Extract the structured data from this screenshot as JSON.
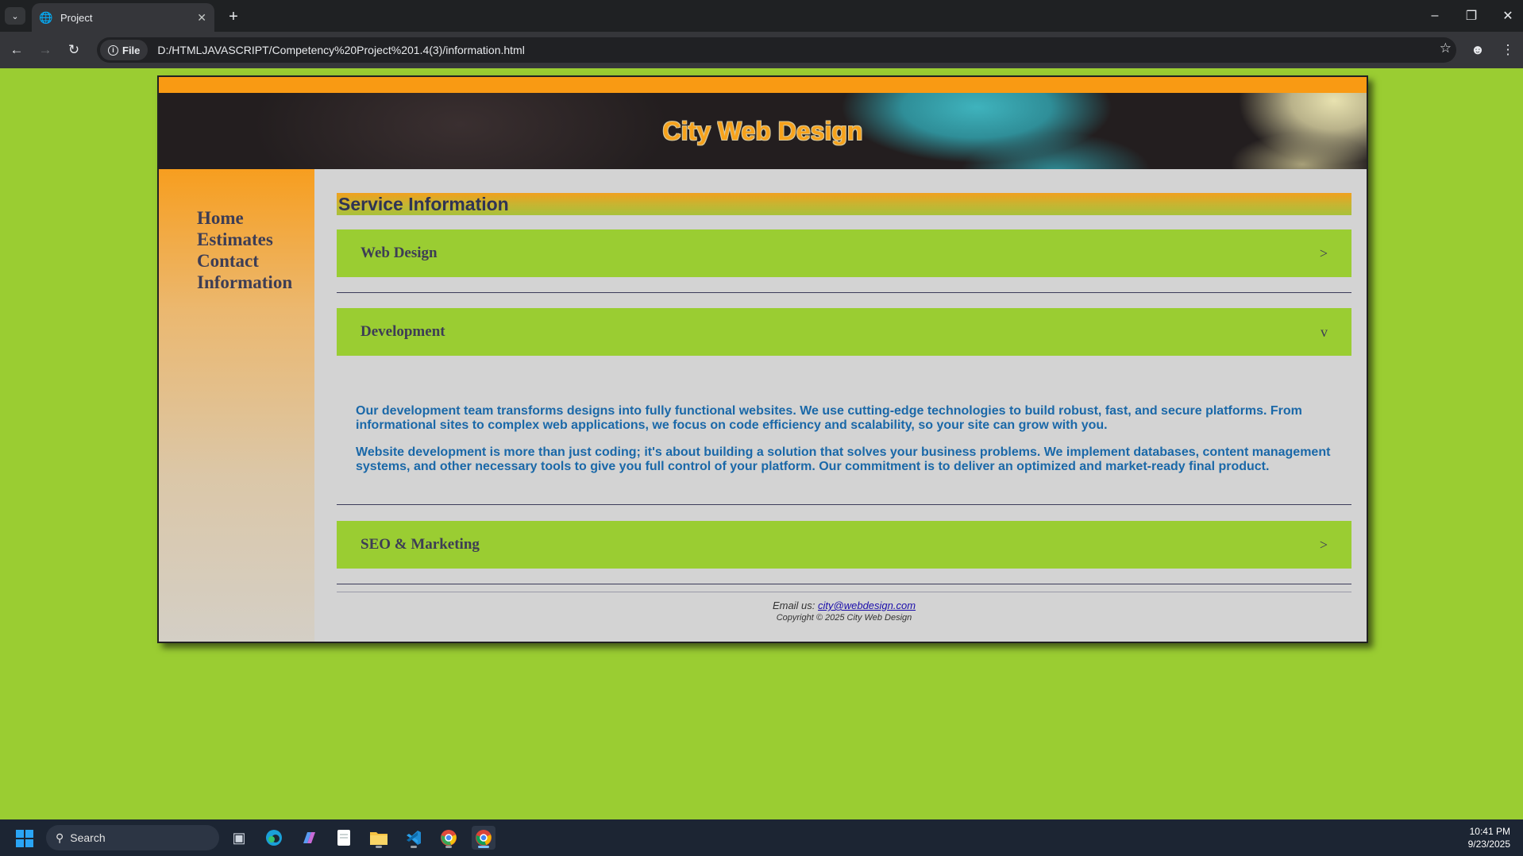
{
  "browser": {
    "tab": {
      "title": "Project"
    },
    "address_bar": {
      "chip_label": "File",
      "url": "D:/HTMLJAVASCRIPT/Competency%20Project%201.4(3)/information.html"
    }
  },
  "site": {
    "title": "City Web Design",
    "nav": [
      {
        "label": "Home"
      },
      {
        "label": "Estimates"
      },
      {
        "label": "Contact"
      },
      {
        "label": "Information"
      }
    ],
    "section_title": "Service Information",
    "accordion": [
      {
        "title": "Web Design",
        "indicator": ">",
        "expanded": false
      },
      {
        "title": "Development",
        "indicator": "v",
        "expanded": true,
        "paragraphs": [
          "Our development team transforms designs into fully functional websites. We use cutting-edge technologies to build robust, fast, and secure platforms. From informational sites to complex web applications, we focus on code efficiency and scalability, so your site can grow with you.",
          "Website development is more than just coding; it's about building a solution that solves your business problems. We implement databases, content management systems, and other necessary tools to give you full control of your platform. Our commitment is to deliver an optimized and market-ready final product."
        ]
      },
      {
        "title": "SEO & Marketing",
        "indicator": ">",
        "expanded": false
      }
    ],
    "footer": {
      "email_label": "Email us:",
      "email": "city@webdesign.com",
      "copyright": "Copyright © 2025 City Web Design"
    }
  },
  "taskbar": {
    "search_placeholder": "Search",
    "time": "10:41 PM",
    "date": "9/23/2025"
  },
  "colors": {
    "page_background": "#9acd32",
    "accent_orange": "#f99a13",
    "nav_text": "#3d3d55",
    "body_text": "#1a68a8"
  }
}
